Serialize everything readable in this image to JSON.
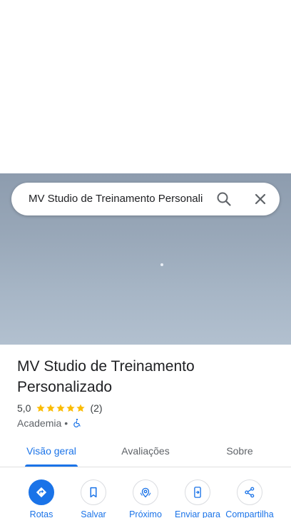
{
  "search": {
    "query": "MV Studio de Treinamento Personali"
  },
  "place": {
    "title": "MV Studio de Treinamento Personalizado",
    "rating": "5,0",
    "stars": 5,
    "review_count": "(2)",
    "category": "Academia",
    "separator": "•"
  },
  "tabs": [
    {
      "label": "Visão geral",
      "active": true
    },
    {
      "label": "Avaliações",
      "active": false
    },
    {
      "label": "Sobre",
      "active": false
    }
  ],
  "actions": [
    {
      "label": "Rotas",
      "icon": "directions-icon"
    },
    {
      "label": "Salvar",
      "icon": "bookmark-icon"
    },
    {
      "label": "Próximo",
      "icon": "nearby-icon"
    },
    {
      "label": "Enviar para",
      "icon": "send-to-phone-icon"
    },
    {
      "label": "Compartilha",
      "icon": "share-icon"
    }
  ],
  "colors": {
    "accent": "#1a73e8",
    "star": "#fbbc04",
    "text": "#202124",
    "muted": "#5f6368"
  }
}
